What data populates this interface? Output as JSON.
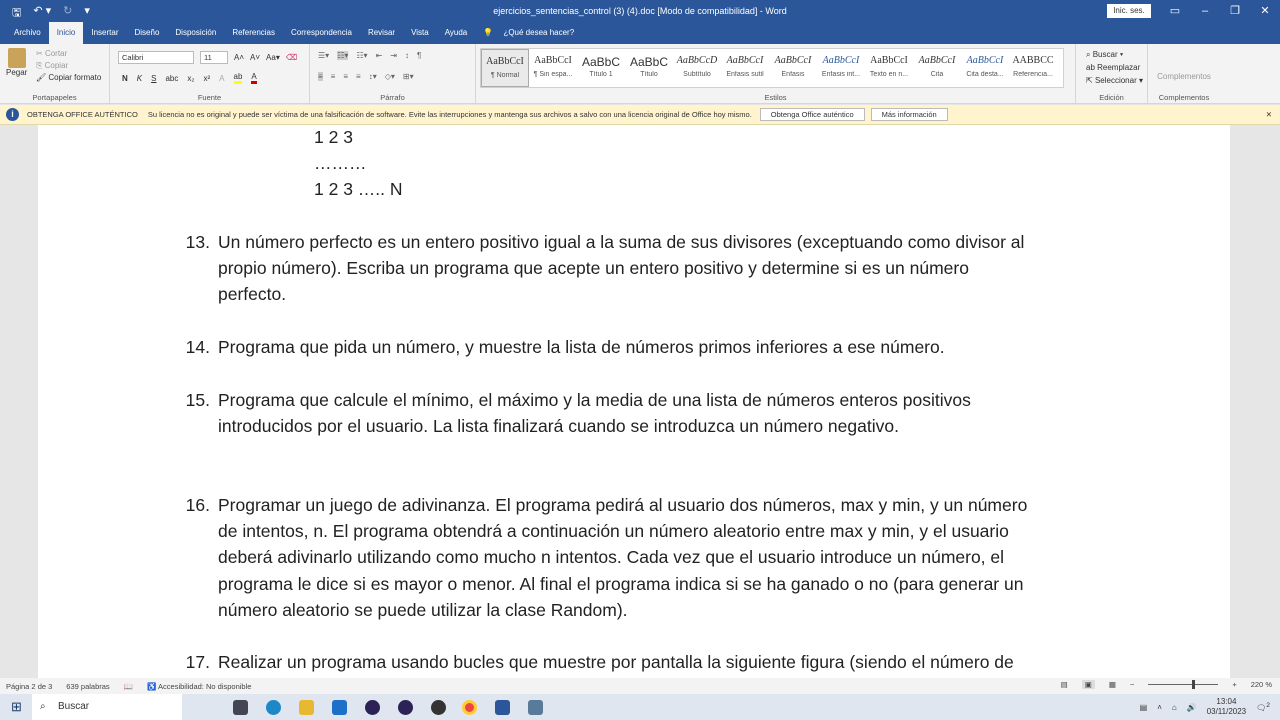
{
  "window": {
    "title": "ejercicios_sentencias_control (3) (4).doc [Modo de compatibilidad] - Word",
    "signin": "Inic. ses."
  },
  "tabs": [
    "Archivo",
    "Inicio",
    "Insertar",
    "Diseño",
    "Disposición",
    "Referencias",
    "Correspondencia",
    "Revisar",
    "Vista",
    "Ayuda",
    "¿Qué desea hacer?"
  ],
  "ribbon": {
    "clipboard": {
      "paste": "Pegar",
      "cut": "Cortar",
      "copy": "Copiar",
      "format": "Copiar formato",
      "label": "Portapapeles"
    },
    "font": {
      "name": "Calibri",
      "size": "11",
      "label": "Fuente",
      "bold": "N",
      "italic": "K",
      "underline": "S"
    },
    "paragraph": {
      "label": "Párrafo"
    },
    "styles": {
      "label": "Estilos",
      "items": [
        {
          "preview": "AaBbCcI",
          "name": "¶ Normal"
        },
        {
          "preview": "AaBbCcI",
          "name": "¶ Sin espa..."
        },
        {
          "preview": "AaBbC",
          "name": "Título 1"
        },
        {
          "preview": "AaBbC",
          "name": "Título"
        },
        {
          "preview": "AaBbCcD",
          "name": "Subtítulo"
        },
        {
          "preview": "AaBbCcI",
          "name": "Énfasis sutil"
        },
        {
          "preview": "AaBbCcI",
          "name": "Énfasis"
        },
        {
          "preview": "AaBbCcI",
          "name": "Énfasis int..."
        },
        {
          "preview": "AaBbCcI",
          "name": "Texto en n..."
        },
        {
          "preview": "AaBbCcI",
          "name": "Cita"
        },
        {
          "preview": "AaBbCcI",
          "name": "Cita desta..."
        },
        {
          "preview": "AABBCC",
          "name": "Referencia..."
        }
      ]
    },
    "editing": {
      "find": "Buscar",
      "replace": "Reemplazar",
      "select": "Seleccionar",
      "label": "Edición"
    },
    "addins": {
      "button": "Complementos",
      "label": "Complementos"
    }
  },
  "infobar": {
    "title": "OBTENGA OFFICE AUTÉNTICO",
    "message": "Su licencia no es original y puede ser víctima de una falsificación de software. Evite las interrupciones y mantenga sus archivos a salvo con una licencia original de Office hoy mismo.",
    "btn1": "Obtenga Office auténtico",
    "btn2": "Más información"
  },
  "document": {
    "top_lines": [
      "1 2 3",
      "………",
      "1 2 3 ….. N"
    ],
    "items": [
      {
        "num": "13.",
        "lines": [
          "Un número perfecto es un entero positivo igual a la suma de sus divisores (exceptuando como divisor al",
          "propio número). Escriba un programa que acepte un entero positivo y determine si es un número",
          "perfecto."
        ]
      },
      {
        "num": "14.",
        "lines": [
          "Programa que pida un número, y muestre la lista de números primos inferiores a ese número."
        ]
      },
      {
        "num": "15.",
        "lines": [
          "Programa que calcule el mínimo, el máximo y la media de una lista de números enteros positivos",
          "introducidos por el usuario. La lista finalizará cuando se introduzca un número negativo."
        ]
      },
      {
        "num": "16.",
        "lines": [
          "Programar un juego de adivinanza. El programa pedirá al usuario dos números, max y min, y un número",
          "de intentos, n. El programa obtendrá a continuación un número aleatorio entre max y min, y el usuario",
          "deberá adivinarlo utilizando como mucho n intentos. Cada vez que el usuario introduce un número, el",
          "programa le dice si es mayor o menor. Al final el programa  indica si se ha ganado o no (para generar un",
          "número aleatorio se puede utilizar la clase Random)."
        ]
      },
      {
        "num": "17.",
        "lines": [
          "Realizar un programa usando bucles que muestre por pantalla la siguiente figura (siendo el número de"
        ]
      }
    ]
  },
  "status": {
    "page": "Página 2 de 3",
    "words": "639 palabras",
    "accessibility": "Accesibilidad: No disponible",
    "zoom": "220 %"
  },
  "taskbar": {
    "search": "Buscar",
    "time": "13:04",
    "date": "03/11/2023",
    "notifications": "2"
  }
}
